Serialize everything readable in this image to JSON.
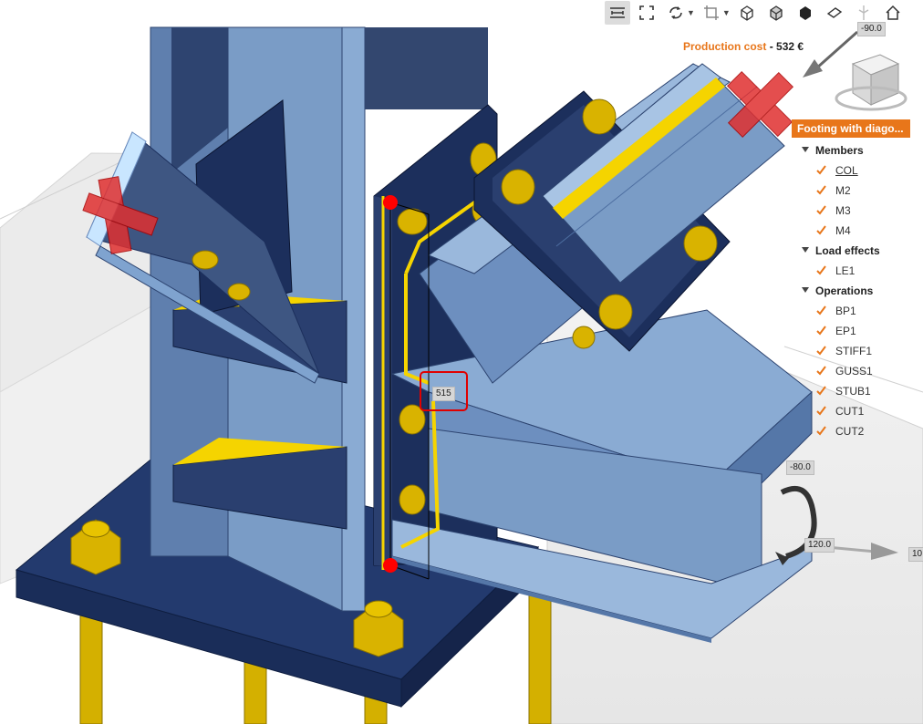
{
  "toolbar": {
    "buttons": [
      {
        "name": "measure-icon",
        "active": true
      },
      {
        "name": "zoom-fit-icon"
      },
      {
        "name": "rotate-icon",
        "caret": true
      },
      {
        "name": "crop-icon",
        "caret": true
      },
      {
        "name": "wireframe-cube-icon"
      },
      {
        "name": "transparent-cube-icon"
      },
      {
        "name": "solid-cube-icon"
      },
      {
        "name": "eraser-icon"
      },
      {
        "name": "section-icon"
      },
      {
        "name": "home-icon"
      }
    ]
  },
  "header": {
    "cost_label": "Production cost",
    "cost_sep": "-",
    "cost_value": "532 €",
    "project_name": "Footing with diago..."
  },
  "tree": {
    "groups": [
      {
        "label": "Members",
        "items": [
          "COL",
          "M2",
          "M3",
          "M4"
        ]
      },
      {
        "label": "Load effects",
        "items": [
          "LE1"
        ]
      },
      {
        "label": "Operations",
        "items": [
          "BP1",
          "EP1",
          "STIFF1",
          "GUSS1",
          "STUB1",
          "CUT1",
          "CUT2"
        ]
      }
    ]
  },
  "viewport": {
    "dimension_value": "515",
    "gizmo_top_label": "-90.0",
    "gizmo_rot_label": "-80.0",
    "gizmo_angle_label": "120.0",
    "gizmo_right_label": "10"
  },
  "colors": {
    "accent": "#e8761a",
    "steel_light": "#7a9cc6",
    "steel_dark": "#1c2f5c",
    "weld": "#f5d400",
    "bolt": "#d9b300",
    "highlight": "#e00000"
  }
}
